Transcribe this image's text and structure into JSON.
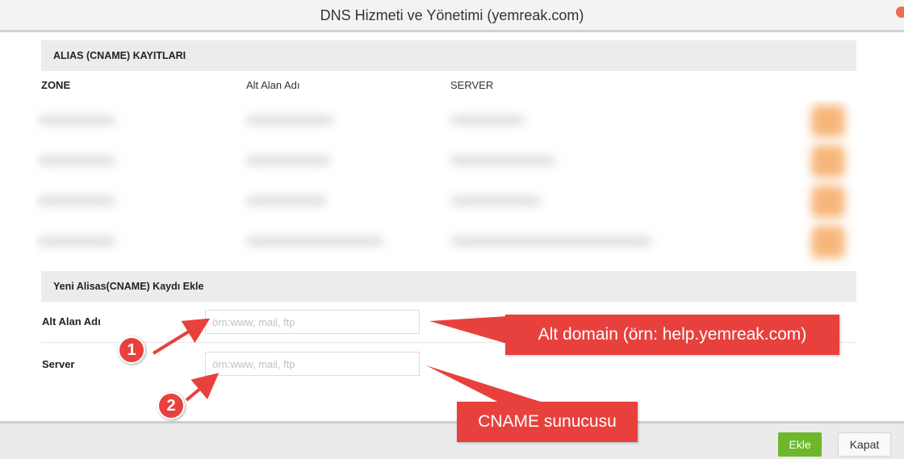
{
  "window": {
    "title": "DNS Hizmeti ve Yönetimi (yemreak.com)"
  },
  "cname_section": {
    "title": "ALIAS (CNAME) KAYITLARI",
    "columns": [
      "ZONE",
      "Alt Alan Adı",
      "SERVER"
    ]
  },
  "add_section": {
    "title": "Yeni Alisas(CNAME) Kaydı Ekle",
    "fields": [
      {
        "label": "Alt Alan Adı",
        "value": "",
        "placeholder": "örn:www, mail, ftp"
      },
      {
        "label": "Server",
        "value": "",
        "placeholder": "örn:www, mail, ftp"
      }
    ]
  },
  "footer": {
    "add_label": "Ekle",
    "close_label": "Kapat"
  },
  "annotations": {
    "callout_subdomain": "Alt domain (örn: help.yemreak.com)",
    "callout_cname": "CNAME sunucusu",
    "badge_1": "1",
    "badge_2": "2"
  },
  "colors": {
    "accent_red": "#e8413d",
    "add_button_green": "#6cb72b",
    "row_action_orange": "#f5a55a",
    "window_dot": "#f26b4c"
  }
}
